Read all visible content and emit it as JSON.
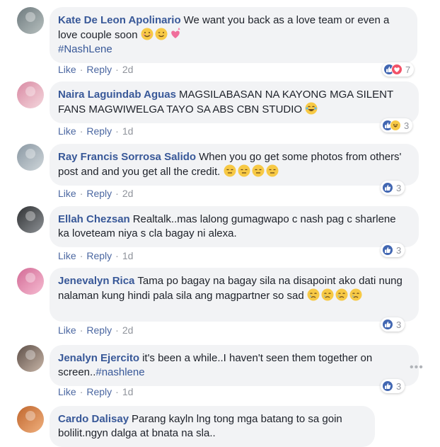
{
  "actions": {
    "like": "Like",
    "reply": "Reply",
    "separator": "·"
  },
  "more_options": "•••",
  "comments": [
    {
      "author": "Kate De Leon Apolinario",
      "text": "We want you back as a love team or even a love couple soon",
      "hashtag": "#NashLene",
      "emojis": [
        "smiling-face-icon",
        "winking-face-icon",
        "growing-heart-icon"
      ],
      "age": "2d",
      "reactions": [
        "like",
        "love"
      ],
      "reaction_count": "7"
    },
    {
      "author": "Naira Laguindab Aguas",
      "text": "MAGSILABASAN NA KAYONG MGA SILENT FANS MAGWIWELGA TAYO SA ABS CBN STUDIO",
      "emojis": [
        "tears-of-joy-icon"
      ],
      "age": "1d",
      "reactions": [
        "like",
        "haha"
      ],
      "reaction_count": "3"
    },
    {
      "author": "Ray Francis Sorrosa Salido",
      "text": "When you go get some photos from others' post and and you get all the credit.",
      "emojis": [
        "expressionless-face-icon",
        "expressionless-face-icon",
        "expressionless-face-icon",
        "expressionless-face-icon"
      ],
      "age": "2d",
      "reactions": [
        "like"
      ],
      "reaction_count": "3"
    },
    {
      "author": "Ellah Chezsan",
      "text": "Realtalk..mas lalong gumagwapo c nash pag c sharlene ka loveteam niya s cla bagay ni alexa.",
      "age": "1d",
      "reactions": [
        "like"
      ],
      "reaction_count": "3"
    },
    {
      "author": "Jenevalyn Rica",
      "text": "Tama po bagay na bagay sila na disapoint ako dati nung nalaman kung hindi pala sila ang magpartner so sad",
      "emojis": [
        "crying-face-icon",
        "crying-face-icon",
        "crying-face-icon",
        "crying-face-icon"
      ],
      "age": "2d",
      "reactions": [
        "like"
      ],
      "reaction_count": "3"
    },
    {
      "author": "Jenalyn Ejercito",
      "text": "it's been a while..I haven't seen them together on screen..",
      "hashtag": "#nashlene",
      "age": "1d",
      "reactions": [
        "like"
      ],
      "reaction_count": "3"
    },
    {
      "author": "Cardo Dalisay",
      "text": "Parang kayln lng tong mga batang to sa goin bolilit.ngyn dalga at bnata na sla..",
      "age": "",
      "reactions": [],
      "reaction_count": ""
    }
  ]
}
